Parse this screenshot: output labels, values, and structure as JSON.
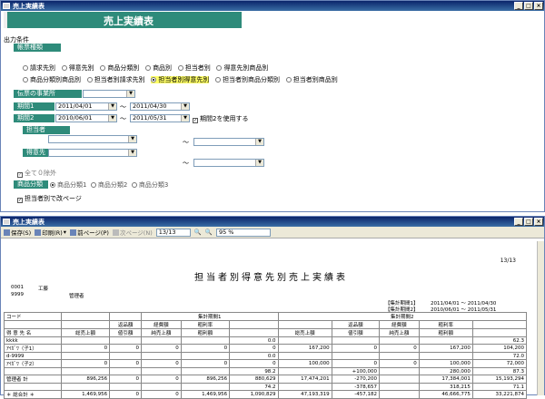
{
  "window1": {
    "title": "売上実績表",
    "banner": "売上実績表"
  },
  "form": {
    "section": "出力条件",
    "report_type_label": "帳票種類",
    "row1": [
      "請求先別",
      "得意先別",
      "商品分類別",
      "商品別",
      "担当者別",
      "得意先別商品別"
    ],
    "row2": [
      "商品分類別商品別",
      "担当者別請求先別",
      "担当者別得意先別",
      "担当者別商品分類別",
      "担当者別商品別"
    ],
    "office_label": "伝票の事業所",
    "period1_label": "期間1",
    "period1_from": "2011/04/01",
    "period1_to": "2011/04/30",
    "period2_label": "期間2",
    "period2_from": "2010/06/01",
    "period2_to": "2011/05/31",
    "period2_use": "期間2を使用する",
    "person_label": "担当者",
    "customer_label": "得意先",
    "tilde": "〜",
    "exclude_zero": "全て０除外",
    "cat_label": "商品分類",
    "cats": [
      "商品分類1",
      "商品分類2",
      "商品分類3"
    ],
    "pagebreak": "担当者別で改ページ"
  },
  "window2": {
    "title": "売上実績表"
  },
  "toolbar": {
    "save": "保存(S)",
    "print": "印刷(R)",
    "prev": "前ページ(P)",
    "next": "次ページ(N)",
    "page": "13/13",
    "zoom": "95 %"
  },
  "report": {
    "page": "13/13",
    "title": "担当者別得意先別売上実績表",
    "code1": "0001",
    "name1": "工藤",
    "code2": "9999",
    "name2": "管理者",
    "p1_label": "【集計期間1】",
    "p1_range": "2011/04/01 〜 2011/04/30",
    "p2_label": "【集計期間2】",
    "p2_range": "2010/06/01 〜 2011/05/31",
    "h_code": "コード",
    "h_name": "得 意 先 名",
    "h_p1": "集計期間1",
    "h_p2": "集計期間2",
    "h_ret": "返品額",
    "h_dis": "値引額",
    "h_cost": "経費額",
    "h_net": "純売上額",
    "h_gp": "粗利額",
    "h_gpr": "粗利率",
    "h_gross": "総売上額",
    "rows": [
      [
        "kkkk",
        "",
        "",
        "",
        "",
        "0.0",
        "",
        "",
        "",
        "",
        "62.3"
      ],
      [
        "ｱｲｶﾞﾜ（子1）",
        "0",
        "0",
        "0",
        "0",
        "0",
        "167,200",
        "0",
        "0",
        "167,200",
        "104,200"
      ],
      [
        "d-9999",
        "",
        "",
        "",
        "",
        "0.0",
        "",
        "",
        "",
        "",
        "72.0"
      ],
      [
        "ｱｲｶﾞﾜ（子2）",
        "0",
        "0",
        "0",
        "0",
        "0",
        "100,000",
        "0",
        "0",
        "100,000",
        "72,000"
      ],
      [
        "",
        "",
        "",
        "",
        "",
        "98.2",
        "",
        "+100,000",
        "",
        "280,000",
        "87.3"
      ],
      [
        "管理者 計",
        "896,256",
        "0",
        "0",
        "896,256",
        "880,629",
        "17,474,201",
        "-270,200",
        "",
        "17,384,001",
        "15,193,294"
      ],
      [
        "",
        "",
        "",
        "",
        "",
        "74.2",
        "",
        "-378,657",
        "",
        "318,215",
        "71.1"
      ],
      [
        "＊ 総合計 ＊",
        "1,469,956",
        "0",
        "0",
        "1,469,956",
        "1,090,829",
        "47,193,319",
        "-457,182",
        "",
        "46,666,775",
        "33,221,874"
      ]
    ]
  }
}
